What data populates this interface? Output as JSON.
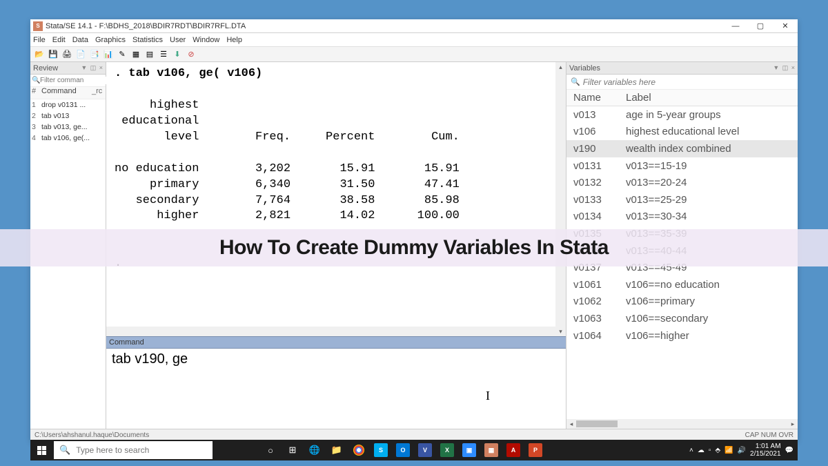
{
  "window": {
    "title": "Stata/SE 14.1 - F:\\BDHS_2018\\BDIR7RDT\\BDIR7RFL.DTA"
  },
  "menu": [
    "File",
    "Edit",
    "Data",
    "Graphics",
    "Statistics",
    "User",
    "Window",
    "Help"
  ],
  "review": {
    "title": "Review",
    "filter_placeholder": "Filter comman",
    "cols": {
      "num": "#",
      "cmd": "Command",
      "rc": "_rc"
    },
    "items": [
      {
        "n": "1",
        "cmd": "drop v0131 ..."
      },
      {
        "n": "2",
        "cmd": "tab v013"
      },
      {
        "n": "3",
        "cmd": "tab v013, ge..."
      },
      {
        "n": "4",
        "cmd": "tab v106, ge(..."
      }
    ]
  },
  "results": {
    "command_line": ". tab v106, ge( v106)",
    "header_l1": "     highest",
    "header_l2": " educational",
    "header_l3": "       level        Freq.     Percent        Cum.",
    "rows": [
      "no education        3,202       15.91       15.91",
      "     primary        6,340       31.50       47.41",
      "   secondary        7,764       38.58       85.98",
      "      higher        2,821       14.02      100.00"
    ],
    "dot": "."
  },
  "command": {
    "label": "Command",
    "value": "tab v190, ge"
  },
  "variables": {
    "title": "Variables",
    "filter_placeholder": "Filter variables here",
    "cols": {
      "name": "Name",
      "label": "Label"
    },
    "rows": [
      {
        "name": "v013",
        "label": "age in 5-year groups",
        "sel": false
      },
      {
        "name": "v106",
        "label": "highest educational level",
        "sel": false
      },
      {
        "name": "v190",
        "label": "wealth index combined",
        "sel": true
      },
      {
        "name": "v0131",
        "label": "v013==15-19",
        "sel": false
      },
      {
        "name": "v0132",
        "label": "v013==20-24",
        "sel": false
      },
      {
        "name": "v0133",
        "label": "v013==25-29",
        "sel": false
      },
      {
        "name": "v0134",
        "label": "v013==30-34",
        "sel": false
      },
      {
        "name": "v0135",
        "label": "v013==35-39",
        "sel": false
      },
      {
        "name": "v0136",
        "label": "v013==40-44",
        "sel": false
      },
      {
        "name": "v0137",
        "label": "v013==45-49",
        "sel": false
      },
      {
        "name": "v1061",
        "label": "v106==no education",
        "sel": false
      },
      {
        "name": "v1062",
        "label": "v106==primary",
        "sel": false
      },
      {
        "name": "v1063",
        "label": "v106==secondary",
        "sel": false
      },
      {
        "name": "v1064",
        "label": "v106==higher",
        "sel": false
      }
    ]
  },
  "statusbar": {
    "path": "C:\\Users\\ahshanul.haque\\Documents",
    "indicators": "CAP  NUM  OVR"
  },
  "overlay": {
    "title": "How To Create Dummy Variables In Stata"
  },
  "taskbar": {
    "search_placeholder": "Type here to search",
    "clock_time": "1:01 AM",
    "clock_date": "2/15/2021"
  }
}
